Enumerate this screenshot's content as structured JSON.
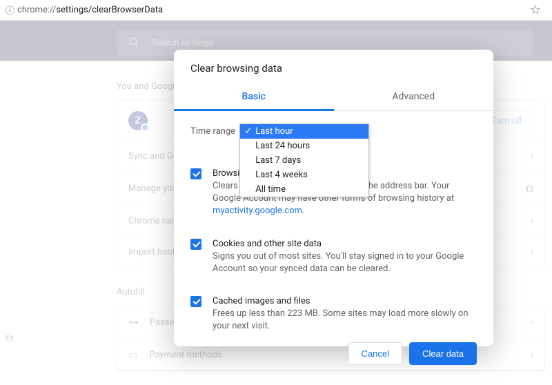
{
  "addressBar": {
    "url_prefix": "chrome://",
    "url_host": "settings",
    "url_path": "/clearBrowserData"
  },
  "search": {
    "placeholder": "Search settings"
  },
  "bg": {
    "youAndGoogle": "You and Google",
    "avatarLetter": "Z",
    "turnOff": "Turn off",
    "rows": {
      "sync": "Sync and Google services",
      "manage": "Manage your Google Account",
      "chromeName": "Chrome name and picture",
      "importBookmarks": "Import bookmarks and settings"
    },
    "autofill": "Autofill",
    "passwords": "Passwords",
    "payments": "Payment methods"
  },
  "dialog": {
    "title": "Clear browsing data",
    "tabs": {
      "basic": "Basic",
      "advanced": "Advanced"
    },
    "timeRangeLabel": "Time range",
    "timeOptions": {
      "lastHour": "Last hour",
      "last24": "Last 24 hours",
      "last7": "Last 7 days",
      "last4w": "Last 4 weeks",
      "allTime": "All time"
    },
    "items": {
      "history": {
        "title": "Browsing history",
        "subtitle_a": "Clears history and autocompletions in the address bar. Your Google Account may have other forms of browsing history at ",
        "link": "myactivity.google.com",
        "subtitle_b": "."
      },
      "cookies": {
        "title": "Cookies and other site data",
        "subtitle": "Signs you out of most sites. You'll stay signed in to your Google Account so your synced data can be cleared."
      },
      "cache": {
        "title": "Cached images and files",
        "subtitle": "Frees up less than 223 MB. Some sites may load more slowly on your next visit."
      }
    },
    "buttons": {
      "cancel": "Cancel",
      "clear": "Clear data"
    }
  }
}
